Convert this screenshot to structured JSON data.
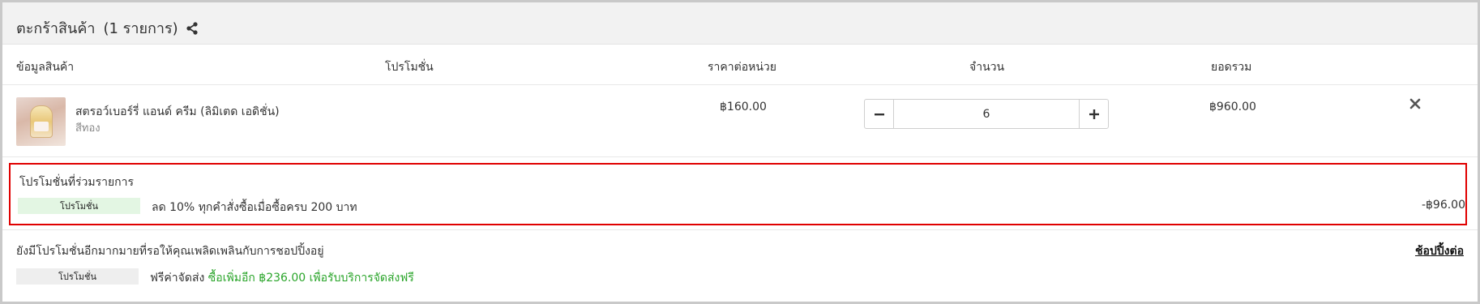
{
  "cart": {
    "title": "ตะกร้าสินค้า",
    "count_label": "(1 รายการ)",
    "share_icon": "share-icon"
  },
  "columns": {
    "product_info": "ข้อมูลสินค้า",
    "promotion": "โปรโมชั่น",
    "unit_price": "ราคาต่อหน่วย",
    "quantity": "จำนวน",
    "total": "ยอดรวม"
  },
  "item": {
    "name": "สตรอว์เบอร์รี่ แอนด์ ครีม (ลิมิเตด เอดิชั่น)",
    "variant": "สีทอง",
    "unit_price": "฿160.00",
    "quantity": "6",
    "line_total": "฿960.00",
    "remove_icon": "close-icon"
  },
  "applied_promotions": {
    "title": "โปรโมชั่นที่ร่วมรายการ",
    "badge": "โปรโมชั่น",
    "description": "ลด 10% ทุกคำสั่งซื้อเมื่อซื้อครบ 200 บาท",
    "discount": "-฿96.00",
    "badge_color": "#e3f6e3",
    "highlight_color": "#e00000"
  },
  "more_promotions": {
    "title": "ยังมีโปรโมชั่นอีกมากมายที่รอให้คุณเพลิดเพลินกับการชอปปิ้งอยู่",
    "shop_more": "ช้อปปิ้งต่อ",
    "badge": "โปรโมชั่น",
    "free_shipping_label": "ฟรีค่าจัดส่ง",
    "free_shipping_hint": "ซื้อเพิ่มอีก ฿236.00 เพื่อรับบริการจัดส่งฟรี",
    "hint_color": "#2aa52a"
  }
}
